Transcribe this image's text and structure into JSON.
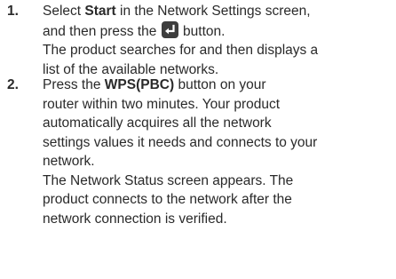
{
  "steps": [
    {
      "number": "1.",
      "line1": {
        "pre": "Select ",
        "bold": "Start",
        "post": " in the Network Settings screen,"
      },
      "line2": {
        "pre": "and then press the ",
        "icon": "enter-icon",
        "post": " button."
      },
      "line3": "The product searches for and then displays a",
      "line4": "list of the available networks."
    },
    {
      "number": "2.",
      "line1": {
        "pre": "Press the ",
        "bold": "WPS(PBC)",
        "post": " button on your"
      },
      "lines": [
        "router within two minutes. Your product",
        "automatically acquires all the network",
        "settings values it needs and connects to your",
        "network.",
        "The Network Status screen appears. The",
        "product connects to the network after the",
        "network connection is verified."
      ]
    }
  ]
}
